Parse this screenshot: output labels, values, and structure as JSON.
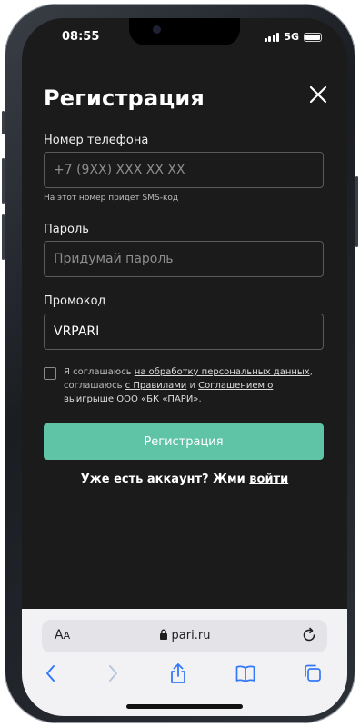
{
  "status_bar": {
    "time": "08:55",
    "network": "5G"
  },
  "form": {
    "title": "Регистрация",
    "phone_label": "Номер телефона",
    "phone_placeholder": "+7 (9XX) XXX XX XX",
    "phone_hint": "На этот номер придет SMS-код",
    "password_label": "Пароль",
    "password_placeholder": "Придумай пароль",
    "promo_label": "Промокод",
    "promo_value": "VRPARI",
    "consent": {
      "part1": "Я соглашаюсь ",
      "link1": "на обработку персональных данных",
      "part2": ", соглашаюсь ",
      "link2": "с Правилами",
      "part3": " и ",
      "link3": "Соглашением о выигрыше ООО «БК «ПАРИ»",
      "part4": "."
    },
    "register_button": "Регистрация",
    "login_prompt": "Уже есть аккаунт? Жми ",
    "login_link": "войти"
  },
  "browser": {
    "aa_big": "A",
    "aa_small": "A",
    "url": "pari.ru"
  },
  "colors": {
    "background": "#1b1b1b",
    "accent": "#5fc4a6",
    "input_border": "#5a5a5a",
    "browser_bar": "#f2f2f4"
  },
  "icons": [
    "close-icon",
    "signal-icon",
    "battery-icon",
    "lock-icon",
    "reload-icon",
    "back-icon",
    "forward-icon",
    "share-icon",
    "bookmarks-icon",
    "tabs-icon"
  ]
}
